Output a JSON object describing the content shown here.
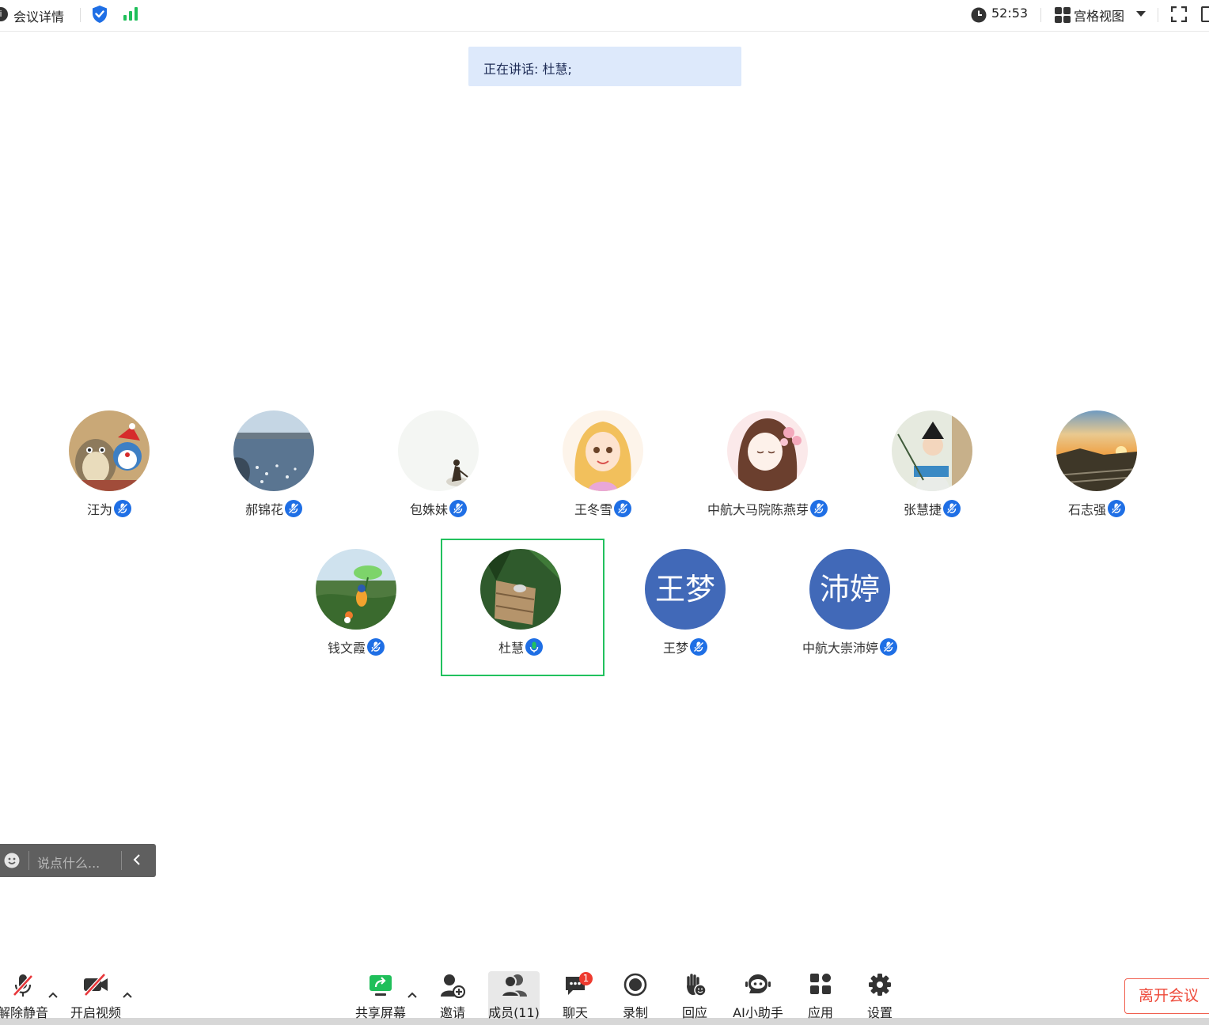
{
  "topbar": {
    "meeting_info_label": "会议详情",
    "timer": "52:53",
    "view_label": "宫格视图",
    "icons": [
      "info-icon",
      "shield-icon",
      "signal-icon",
      "clock-icon",
      "grid-view-icon",
      "chevron-down-icon",
      "fullscreen-icon",
      "window-icon"
    ]
  },
  "speaking": {
    "text": "正在讲话: 杜慧;"
  },
  "participants": [
    {
      "name": "汪为",
      "mic": "muted"
    },
    {
      "name": "郝锦花",
      "mic": "muted"
    },
    {
      "name": "包姝妹",
      "mic": "muted"
    },
    {
      "name": "王冬雪",
      "mic": "muted"
    },
    {
      "name": "中航大马院陈燕芽",
      "mic": "muted"
    },
    {
      "name": "张慧捷",
      "mic": "muted"
    },
    {
      "name": "石志强",
      "mic": "muted"
    },
    {
      "name": "钱文霞",
      "mic": "muted"
    },
    {
      "name": "杜慧",
      "mic": "on",
      "active_speaker": true
    },
    {
      "name": "王梦",
      "mic": "muted",
      "avatar_text": "王梦"
    },
    {
      "name": "中航大崇沛婷",
      "mic": "muted",
      "avatar_text": "沛婷"
    }
  ],
  "chat_input": {
    "placeholder": "说点什么..."
  },
  "toolbar": {
    "unmute": "解除静音",
    "start_video": "开启视频",
    "share_screen": "共享屏幕",
    "invite": "邀请",
    "members": "成员(11)",
    "chat": "聊天",
    "chat_badge": "1",
    "record": "录制",
    "react": "回应",
    "ai_assistant": "AI小助手",
    "apps": "应用",
    "settings": "设置",
    "leave": "离开会议"
  },
  "colors": {
    "accent_blue": "#1f6fe5",
    "active_green": "#22c15e",
    "leave_red": "#ee4a3a",
    "badge_red": "#ee3b2f",
    "text_avatar_bg": "#4169b8",
    "banner_bg": "#dde9fb"
  }
}
